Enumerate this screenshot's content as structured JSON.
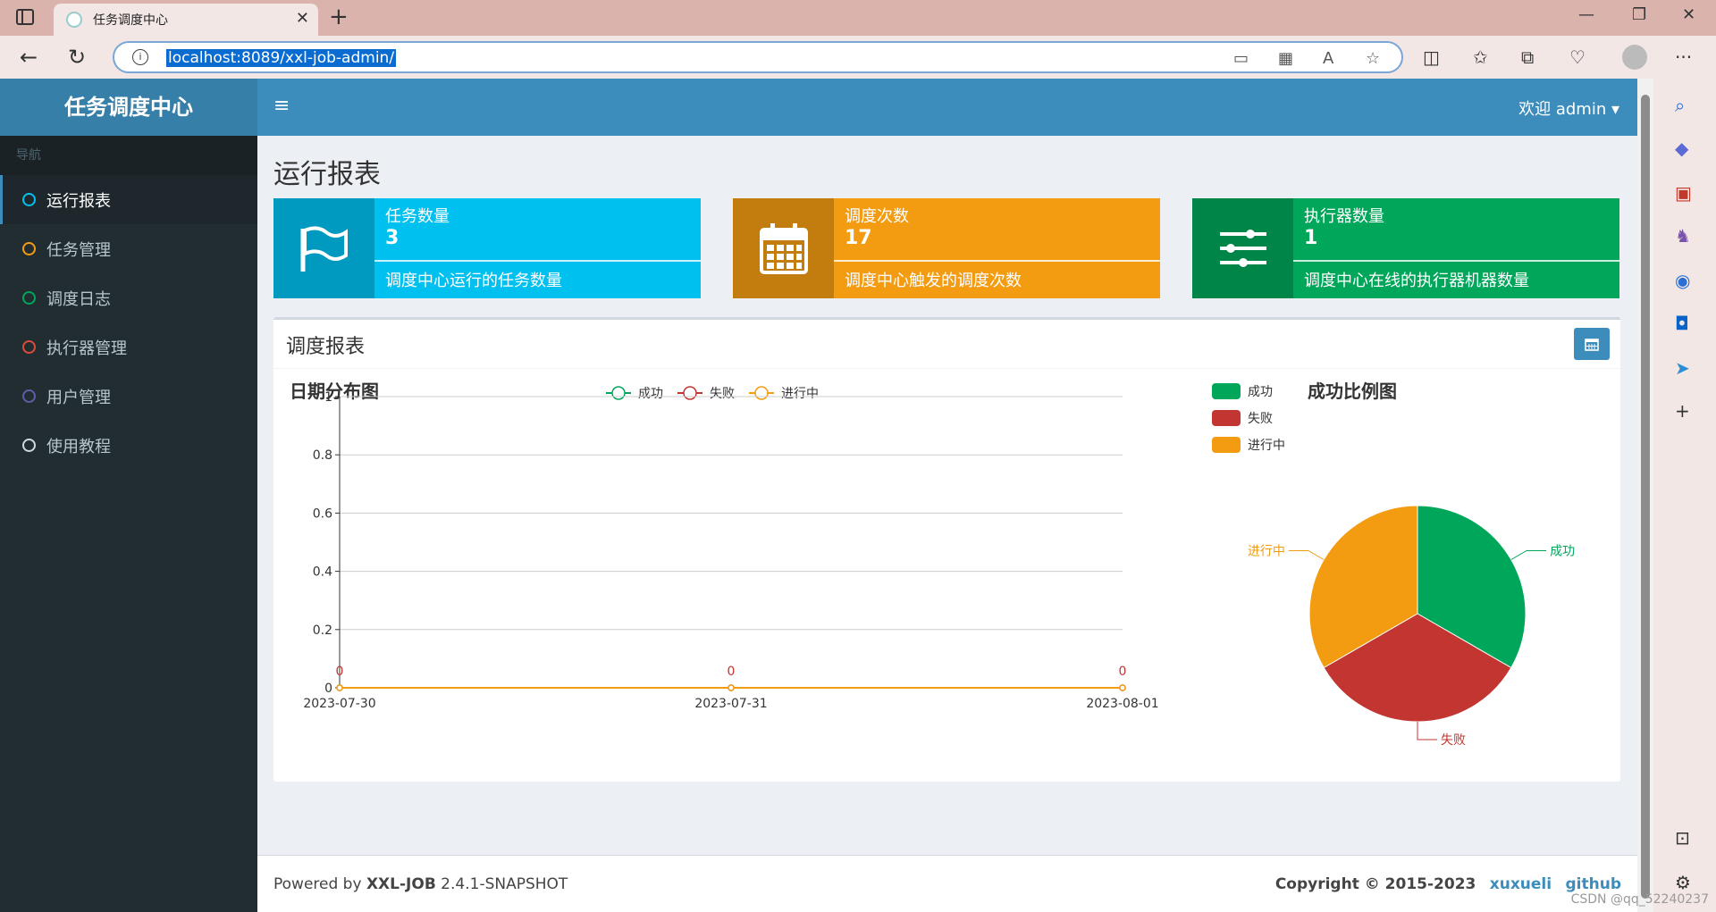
{
  "browser": {
    "tab_title": "任务调度中心",
    "url": "localhost:8089/xxl-job-admin/"
  },
  "app": {
    "logo": "任务调度中心",
    "nav_header": "导航",
    "menu": [
      {
        "label": "运行报表",
        "color": "#00c0ef",
        "active": true
      },
      {
        "label": "任务管理",
        "color": "#f39c12",
        "active": false
      },
      {
        "label": "调度日志",
        "color": "#00a65a",
        "active": false
      },
      {
        "label": "执行器管理",
        "color": "#dd4b39",
        "active": false
      },
      {
        "label": "用户管理",
        "color": "#605ca8",
        "active": false
      },
      {
        "label": "使用教程",
        "color": "#d2d6de",
        "active": false
      }
    ],
    "welcome": "欢迎 admin"
  },
  "page": {
    "title": "运行报表",
    "infoboxes": [
      {
        "label": "任务数量",
        "value": "3",
        "desc": "调度中心运行的任务数量",
        "color": "#00c0ef",
        "icon_color": "#0099bf",
        "icon": "flag-icon"
      },
      {
        "label": "调度次数",
        "value": "17",
        "desc": "调度中心触发的调度次数",
        "color": "#f39c12",
        "icon_color": "#c27d0e",
        "icon": "calendar-icon"
      },
      {
        "label": "执行器数量",
        "value": "1",
        "desc": "调度中心在线的执行器机器数量",
        "color": "#00a65a",
        "icon_color": "#008548",
        "icon": "sliders-icon"
      }
    ],
    "report_title": "调度报表"
  },
  "chart_data": [
    {
      "type": "line",
      "title": "日期分布图",
      "x": [
        "2023-07-30",
        "2023-07-31",
        "2023-08-01"
      ],
      "series": [
        {
          "name": "成功",
          "values": [
            0,
            0,
            0
          ],
          "color": "#00a65a"
        },
        {
          "name": "失败",
          "values": [
            0,
            0,
            0
          ],
          "color": "#c23531"
        },
        {
          "name": "进行中",
          "values": [
            0,
            0,
            0
          ],
          "color": "#f39c12"
        }
      ],
      "yticks": [
        "0",
        "0.2",
        "0.4",
        "0.6",
        "0.8",
        "1"
      ],
      "ylim": [
        0,
        1
      ]
    },
    {
      "type": "pie",
      "title": "成功比例图",
      "labels": [
        "成功",
        "失败",
        "进行中"
      ],
      "values": [
        1,
        1,
        1
      ],
      "colors": [
        "#00a65a",
        "#c23531",
        "#f39c12"
      ]
    }
  ],
  "footer": {
    "powered_prefix": "Powered by ",
    "powered_name": "XXL-JOB",
    "version": " 2.4.1-SNAPSHOT",
    "copyright": "Copyright © 2015-2023",
    "link1": "xuxueli",
    "link2": "github"
  },
  "watermark": "CSDN @qq_52240237"
}
